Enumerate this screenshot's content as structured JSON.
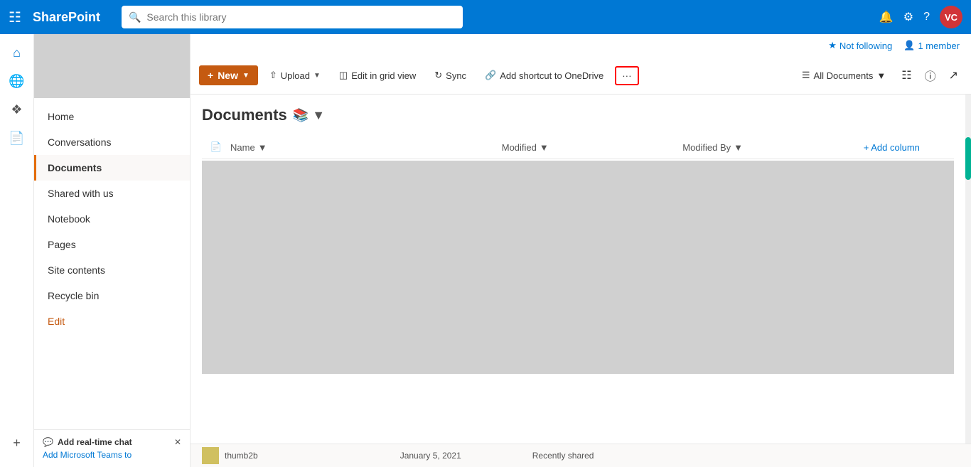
{
  "topnav": {
    "brand": "SharePoint",
    "search_placeholder": "Search this library",
    "avatar_initials": "VC"
  },
  "following": {
    "not_following": "Not following",
    "member_count": "1 member"
  },
  "toolbar": {
    "new_label": "New",
    "upload_label": "Upload",
    "edit_grid_label": "Edit in grid view",
    "sync_label": "Sync",
    "add_shortcut_label": "Add shortcut to OneDrive",
    "more_label": "···",
    "all_documents_label": "All Documents"
  },
  "documents": {
    "title": "Documents",
    "columns": {
      "name": "Name",
      "modified": "Modified",
      "modified_by": "Modified By",
      "add_column": "+ Add column"
    }
  },
  "sidebar": {
    "items": [
      {
        "label": "Home",
        "active": false
      },
      {
        "label": "Conversations",
        "active": false
      },
      {
        "label": "Documents",
        "active": true
      },
      {
        "label": "Shared with us",
        "active": false
      },
      {
        "label": "Notebook",
        "active": false
      },
      {
        "label": "Pages",
        "active": false
      },
      {
        "label": "Site contents",
        "active": false
      },
      {
        "label": "Recycle bin",
        "active": false
      },
      {
        "label": "Edit",
        "active": false,
        "orange": true
      }
    ]
  },
  "sidebar_bottom": {
    "title": "Add real-time chat",
    "subtitle": "Add Microsoft Teams to"
  },
  "icons": {
    "waffle": "⊞",
    "home": "⌂",
    "globe": "🌐",
    "notes": "📋",
    "page": "📄",
    "plus": "+",
    "search": "🔍",
    "upload_arrow": "↑",
    "grid": "⊞",
    "sync": "↻",
    "link": "🔗",
    "filter": "≡",
    "info": "ⓘ",
    "expand": "⤢",
    "star": "☆",
    "person": "👤",
    "chevron_down": "▾",
    "chevron_up": "▴",
    "chat": "💬"
  },
  "bottom_item": {
    "name": "thumb2b",
    "modified": "January 5, 2021",
    "modified_by": "Recently shared"
  }
}
